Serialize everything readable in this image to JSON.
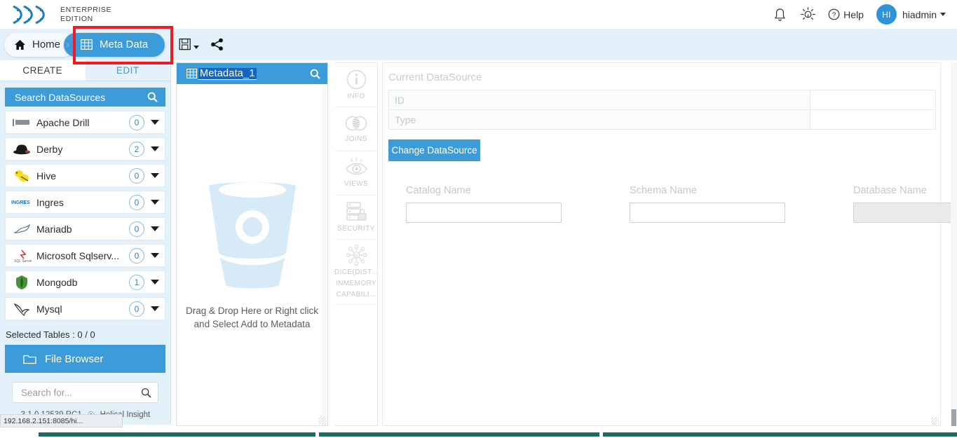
{
  "header": {
    "brand_line1": "ENTERPRISE",
    "brand_line2": "EDITION",
    "logo_icon": "dna-helix-logo",
    "bell_icon": "notification-bell-icon",
    "brightness_icon": "brightness-theme-icon",
    "help_icon": "help-circle-icon",
    "help_label": "Help",
    "avatar_initials": "HI",
    "user_name": "hiadmin",
    "caret_icon": "chevron-down-icon"
  },
  "breadcrumb": {
    "home_label": "Home",
    "home_icon": "home-icon",
    "separator": "›",
    "active_label": "Meta Data",
    "active_icon": "grid-table-icon",
    "save_icon": "save-floppy-icon",
    "save_caret_icon": "chevron-down-icon",
    "share_icon": "share-nodes-icon"
  },
  "sidebar": {
    "tabs": [
      {
        "label": "CREATE",
        "active": true
      },
      {
        "label": "EDIT",
        "active": false
      }
    ],
    "search_datasources_label": "Search DataSources",
    "search_icon": "search-icon",
    "datasources": [
      {
        "name": "Apache Drill",
        "count": "0",
        "icon": "apache-drill-icon"
      },
      {
        "name": "Derby",
        "count": "2",
        "icon": "derby-hat-icon"
      },
      {
        "name": "Hive",
        "count": "0",
        "icon": "hive-bee-icon"
      },
      {
        "name": "Ingres",
        "count": "0",
        "icon": "ingres-icon"
      },
      {
        "name": "Mariadb",
        "count": "0",
        "icon": "mariadb-seal-icon"
      },
      {
        "name": "Microsoft Sqlserv...",
        "count": "0",
        "icon": "mssql-icon"
      },
      {
        "name": "Mongodb",
        "count": "1",
        "icon": "mongodb-leaf-icon"
      },
      {
        "name": "Mysql",
        "count": "0",
        "icon": "mysql-dolphin-icon"
      }
    ],
    "selected_tables_label": "Selected Tables : 0 / 0",
    "file_browser_label": "File Browser",
    "folder_icon": "folder-icon",
    "search_placeholder": "Search for...",
    "version": "3.1.0.12539 RC1",
    "product_name": "Helical Insight",
    "status_text": "192.168.2.151:8085/hi..."
  },
  "metadata_panel": {
    "title": "Metadata_1",
    "title_icon": "grid-table-icon",
    "search_icon": "search-icon",
    "drop_icon": "drop-bucket-icon",
    "drop_text_line1": "Drag & Drop Here or Right click and",
    "drop_text_line2": "Select Add to Metadata",
    "resize_handle": "resize-grip-icon"
  },
  "vertical_tabs": [
    {
      "label": "INFO",
      "icon": "info-circle-icon"
    },
    {
      "label": "JOINS",
      "icon": "venn-joins-icon"
    },
    {
      "label": "VIEWS",
      "icon": "eye-views-icon"
    },
    {
      "label": "SECURITY",
      "icon": "database-lock-icon"
    },
    {
      "label": "DICE(DIST...",
      "label2": "INMEMORY",
      "label3": "CAPABILI...",
      "icon": "network-nodes-icon"
    }
  ],
  "main": {
    "current_datasource_label": "Current DataSource",
    "rows": [
      {
        "key": "ID",
        "value": ""
      },
      {
        "key": "Type",
        "value": ""
      }
    ],
    "change_datasource_label": "Change DataSource",
    "fields": [
      {
        "label": "Catalog Name",
        "value": "",
        "disabled": false
      },
      {
        "label": "Schema Name",
        "value": "",
        "disabled": false
      },
      {
        "label": "Database Name",
        "value": "",
        "disabled": true
      }
    ],
    "resize_handle": "resize-grip-icon"
  },
  "colors": {
    "accent_blue": "#3c9bd9",
    "pale_blue_bg": "#e3f1fa",
    "annotation_red": "#ee1b24",
    "scrollbar_teal": "#1d6b63"
  }
}
